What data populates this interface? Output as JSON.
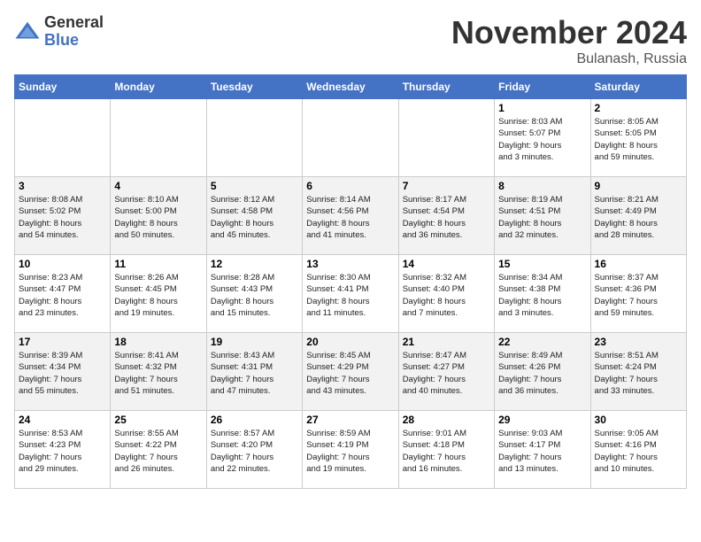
{
  "logo": {
    "general": "General",
    "blue": "Blue"
  },
  "title": "November 2024",
  "location": "Bulanash, Russia",
  "days_of_week": [
    "Sunday",
    "Monday",
    "Tuesday",
    "Wednesday",
    "Thursday",
    "Friday",
    "Saturday"
  ],
  "weeks": [
    [
      {
        "day": "",
        "info": ""
      },
      {
        "day": "",
        "info": ""
      },
      {
        "day": "",
        "info": ""
      },
      {
        "day": "",
        "info": ""
      },
      {
        "day": "",
        "info": ""
      },
      {
        "day": "1",
        "info": "Sunrise: 8:03 AM\nSunset: 5:07 PM\nDaylight: 9 hours\nand 3 minutes."
      },
      {
        "day": "2",
        "info": "Sunrise: 8:05 AM\nSunset: 5:05 PM\nDaylight: 8 hours\nand 59 minutes."
      }
    ],
    [
      {
        "day": "3",
        "info": "Sunrise: 8:08 AM\nSunset: 5:02 PM\nDaylight: 8 hours\nand 54 minutes."
      },
      {
        "day": "4",
        "info": "Sunrise: 8:10 AM\nSunset: 5:00 PM\nDaylight: 8 hours\nand 50 minutes."
      },
      {
        "day": "5",
        "info": "Sunrise: 8:12 AM\nSunset: 4:58 PM\nDaylight: 8 hours\nand 45 minutes."
      },
      {
        "day": "6",
        "info": "Sunrise: 8:14 AM\nSunset: 4:56 PM\nDaylight: 8 hours\nand 41 minutes."
      },
      {
        "day": "7",
        "info": "Sunrise: 8:17 AM\nSunset: 4:54 PM\nDaylight: 8 hours\nand 36 minutes."
      },
      {
        "day": "8",
        "info": "Sunrise: 8:19 AM\nSunset: 4:51 PM\nDaylight: 8 hours\nand 32 minutes."
      },
      {
        "day": "9",
        "info": "Sunrise: 8:21 AM\nSunset: 4:49 PM\nDaylight: 8 hours\nand 28 minutes."
      }
    ],
    [
      {
        "day": "10",
        "info": "Sunrise: 8:23 AM\nSunset: 4:47 PM\nDaylight: 8 hours\nand 23 minutes."
      },
      {
        "day": "11",
        "info": "Sunrise: 8:26 AM\nSunset: 4:45 PM\nDaylight: 8 hours\nand 19 minutes."
      },
      {
        "day": "12",
        "info": "Sunrise: 8:28 AM\nSunset: 4:43 PM\nDaylight: 8 hours\nand 15 minutes."
      },
      {
        "day": "13",
        "info": "Sunrise: 8:30 AM\nSunset: 4:41 PM\nDaylight: 8 hours\nand 11 minutes."
      },
      {
        "day": "14",
        "info": "Sunrise: 8:32 AM\nSunset: 4:40 PM\nDaylight: 8 hours\nand 7 minutes."
      },
      {
        "day": "15",
        "info": "Sunrise: 8:34 AM\nSunset: 4:38 PM\nDaylight: 8 hours\nand 3 minutes."
      },
      {
        "day": "16",
        "info": "Sunrise: 8:37 AM\nSunset: 4:36 PM\nDaylight: 7 hours\nand 59 minutes."
      }
    ],
    [
      {
        "day": "17",
        "info": "Sunrise: 8:39 AM\nSunset: 4:34 PM\nDaylight: 7 hours\nand 55 minutes."
      },
      {
        "day": "18",
        "info": "Sunrise: 8:41 AM\nSunset: 4:32 PM\nDaylight: 7 hours\nand 51 minutes."
      },
      {
        "day": "19",
        "info": "Sunrise: 8:43 AM\nSunset: 4:31 PM\nDaylight: 7 hours\nand 47 minutes."
      },
      {
        "day": "20",
        "info": "Sunrise: 8:45 AM\nSunset: 4:29 PM\nDaylight: 7 hours\nand 43 minutes."
      },
      {
        "day": "21",
        "info": "Sunrise: 8:47 AM\nSunset: 4:27 PM\nDaylight: 7 hours\nand 40 minutes."
      },
      {
        "day": "22",
        "info": "Sunrise: 8:49 AM\nSunset: 4:26 PM\nDaylight: 7 hours\nand 36 minutes."
      },
      {
        "day": "23",
        "info": "Sunrise: 8:51 AM\nSunset: 4:24 PM\nDaylight: 7 hours\nand 33 minutes."
      }
    ],
    [
      {
        "day": "24",
        "info": "Sunrise: 8:53 AM\nSunset: 4:23 PM\nDaylight: 7 hours\nand 29 minutes."
      },
      {
        "day": "25",
        "info": "Sunrise: 8:55 AM\nSunset: 4:22 PM\nDaylight: 7 hours\nand 26 minutes."
      },
      {
        "day": "26",
        "info": "Sunrise: 8:57 AM\nSunset: 4:20 PM\nDaylight: 7 hours\nand 22 minutes."
      },
      {
        "day": "27",
        "info": "Sunrise: 8:59 AM\nSunset: 4:19 PM\nDaylight: 7 hours\nand 19 minutes."
      },
      {
        "day": "28",
        "info": "Sunrise: 9:01 AM\nSunset: 4:18 PM\nDaylight: 7 hours\nand 16 minutes."
      },
      {
        "day": "29",
        "info": "Sunrise: 9:03 AM\nSunset: 4:17 PM\nDaylight: 7 hours\nand 13 minutes."
      },
      {
        "day": "30",
        "info": "Sunrise: 9:05 AM\nSunset: 4:16 PM\nDaylight: 7 hours\nand 10 minutes."
      }
    ]
  ]
}
